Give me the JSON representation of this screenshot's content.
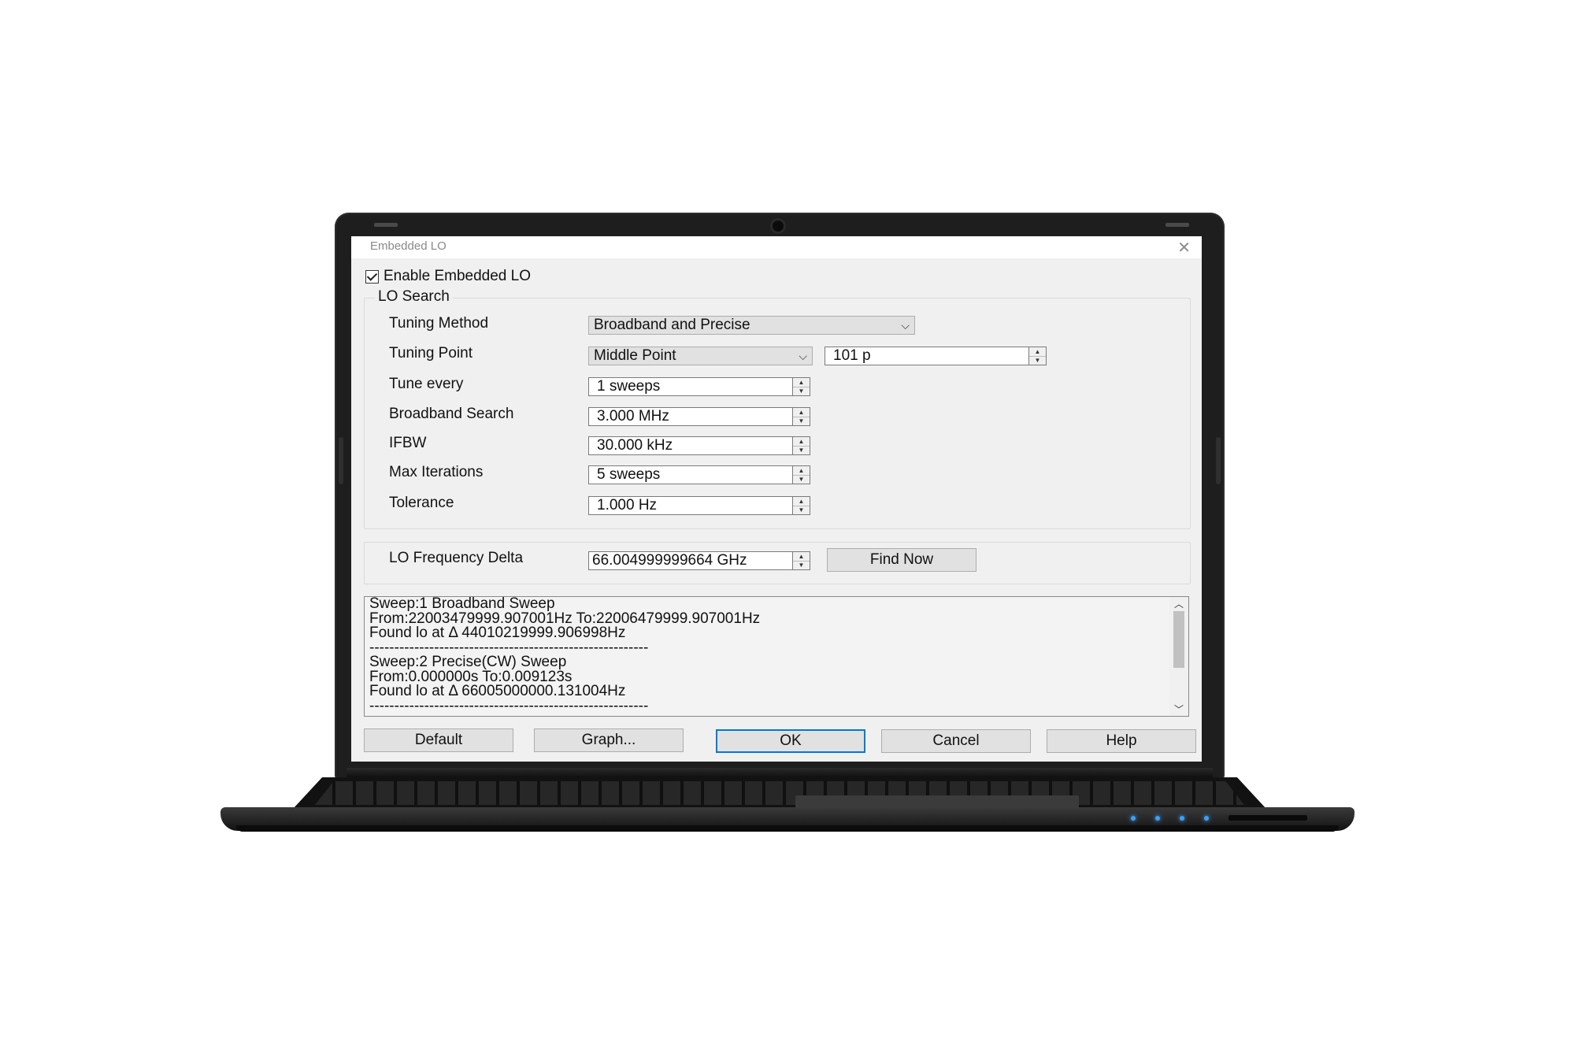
{
  "dialog": {
    "title": "Embedded LO",
    "close_glyph": "✕"
  },
  "enable_checkbox": {
    "label": "Enable Embedded LO",
    "checked": true
  },
  "lo_search": {
    "group_title": "LO Search",
    "tuning_method": {
      "label": "Tuning Method",
      "value": "Broadband and Precise"
    },
    "tuning_point": {
      "label": "Tuning Point",
      "value": "Middle Point",
      "points_value": "101 p"
    },
    "tune_every": {
      "label": "Tune every",
      "value": "1 sweeps"
    },
    "broadband_search": {
      "label": "Broadband Search",
      "value": "3.000 MHz"
    },
    "ifbw": {
      "label": "IFBW",
      "value": "30.000 kHz"
    },
    "max_iterations": {
      "label": "Max Iterations",
      "value": "5 sweeps"
    },
    "tolerance": {
      "label": "Tolerance",
      "value": "1.000 Hz"
    }
  },
  "lo_delta": {
    "label": "LO Frequency Delta",
    "value": "66.004999999664 GHz",
    "find_now": "Find Now"
  },
  "log": {
    "lines": [
      "Sweep:1 Broadband Sweep",
      "From:22003479999.907001Hz To:22006479999.907001Hz",
      "Found lo at   Δ 44010219999.906998Hz",
      "--------------------------------------------------------",
      "Sweep:2 Precise(CW) Sweep",
      "From:0.000000s To:0.009123s",
      "Found lo at   Δ 66005000000.131004Hz",
      "--------------------------------------------------------"
    ],
    "scroll_up_glyph": "︿",
    "scroll_down_glyph": "﹀"
  },
  "buttons": {
    "default": "Default",
    "graph": "Graph...",
    "ok": "OK",
    "cancel": "Cancel",
    "help": "Help"
  },
  "glyphs": {
    "chevron_down": "⌵",
    "spin_up": "▲",
    "spin_down": "▼"
  },
  "colors": {
    "accent": "#0078d7",
    "dialog_bg": "#f0f0f0",
    "status_led": "#3aa0ff"
  }
}
